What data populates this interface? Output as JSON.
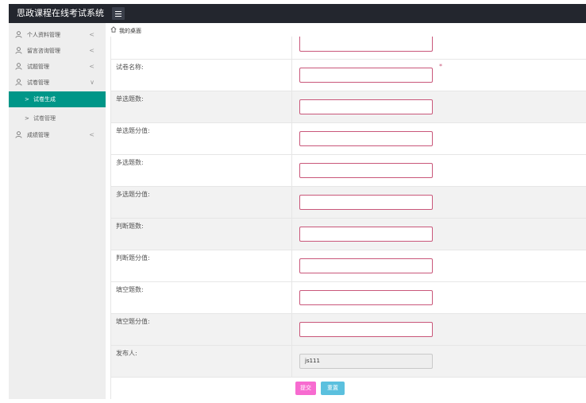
{
  "header": {
    "app_title": "思政课程在线考试系统",
    "menu_icon": "hamburger-icon"
  },
  "sidebar": {
    "items": [
      {
        "label": "个人资料管理",
        "icon": "user-icon",
        "chevron": "<"
      },
      {
        "label": "留言咨询管理",
        "icon": "user-icon",
        "chevron": "<"
      },
      {
        "label": "试题管理",
        "icon": "user-icon",
        "chevron": "<"
      },
      {
        "label": "试卷管理",
        "icon": "user-icon",
        "chevron": "∨"
      },
      {
        "label": "成绩管理",
        "icon": "user-icon",
        "chevron": "<"
      }
    ],
    "sub_items": [
      {
        "label": "试卷生成",
        "arrow": ">",
        "active": true
      },
      {
        "label": "试卷管理",
        "arrow": ">",
        "active": false
      }
    ]
  },
  "breadcrumb": {
    "home": "我的桌面"
  },
  "form": {
    "rows": [
      {
        "label": "试卷名称:",
        "value": "",
        "required": "*"
      },
      {
        "label": "单选题数:",
        "value": ""
      },
      {
        "label": "单选题分值:",
        "value": ""
      },
      {
        "label": "多选题数:",
        "value": ""
      },
      {
        "label": "多选题分值:",
        "value": ""
      },
      {
        "label": "判断题数:",
        "value": ""
      },
      {
        "label": "判断题分值:",
        "value": ""
      },
      {
        "label": "填空题数:",
        "value": ""
      },
      {
        "label": "填空题分值:",
        "value": ""
      },
      {
        "label": "发布人:",
        "value": "js111"
      }
    ],
    "submit_label": "提交",
    "reset_label": "重置"
  },
  "colors": {
    "header_bg": "#23262e",
    "accent": "#009688",
    "field_border": "#c9577a",
    "submit_bg": "#f76bd0",
    "reset_bg": "#5bc0de"
  }
}
